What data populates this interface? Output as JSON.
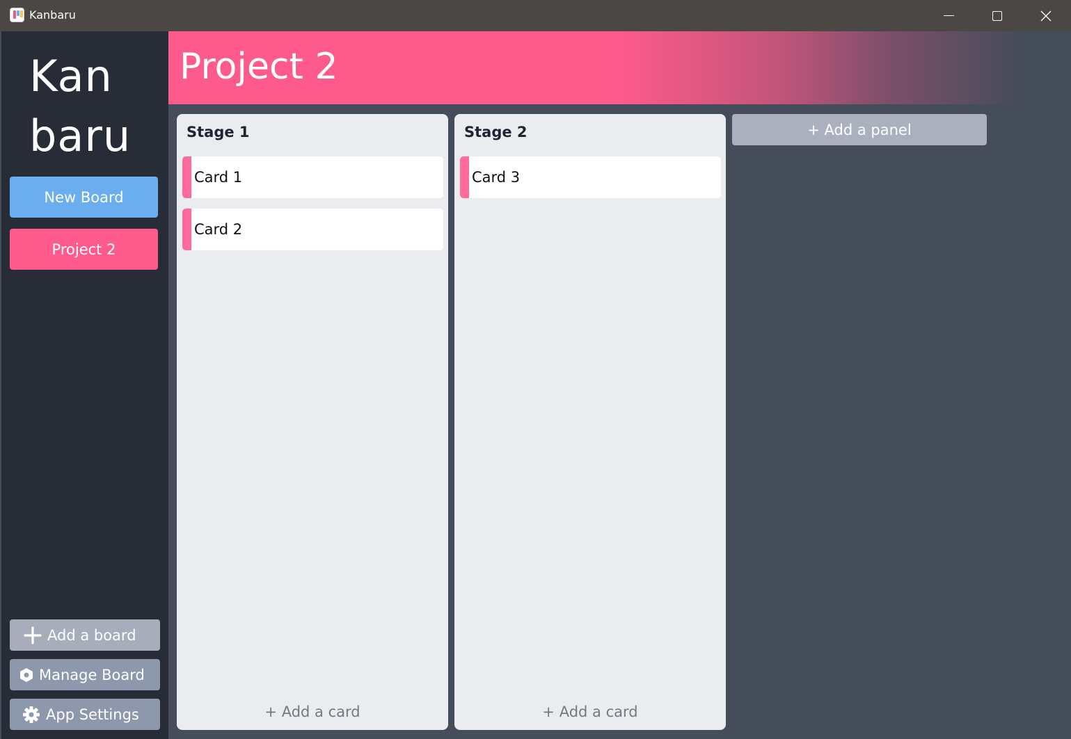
{
  "window": {
    "title": "Kanbaru",
    "icon": "kanban-app-icon"
  },
  "sidebar": {
    "logo_line1": "Kan",
    "logo_line2": "baru",
    "new_board_label": "New Board",
    "boards": [
      {
        "label": "Project 2",
        "active": true
      }
    ],
    "add_board_label": "Add a board",
    "manage_board_label": "Manage Board",
    "app_settings_label": "App Settings"
  },
  "board": {
    "title": "Project 2",
    "panels": [
      {
        "title": "Stage 1",
        "cards": [
          {
            "title": "Card 1"
          },
          {
            "title": "Card 2"
          }
        ],
        "add_card_label": "+ Add a card"
      },
      {
        "title": "Stage 2",
        "cards": [
          {
            "title": "Card 3"
          }
        ],
        "add_card_label": "+ Add a card"
      }
    ],
    "add_panel_label": "+ Add a panel"
  },
  "colors": {
    "accent_pink": "#fe5a8c",
    "accent_blue": "#6aaef0",
    "sidebar_bg": "#282c37",
    "main_bg": "#464d5a",
    "panel_bg": "#ebecf0"
  }
}
